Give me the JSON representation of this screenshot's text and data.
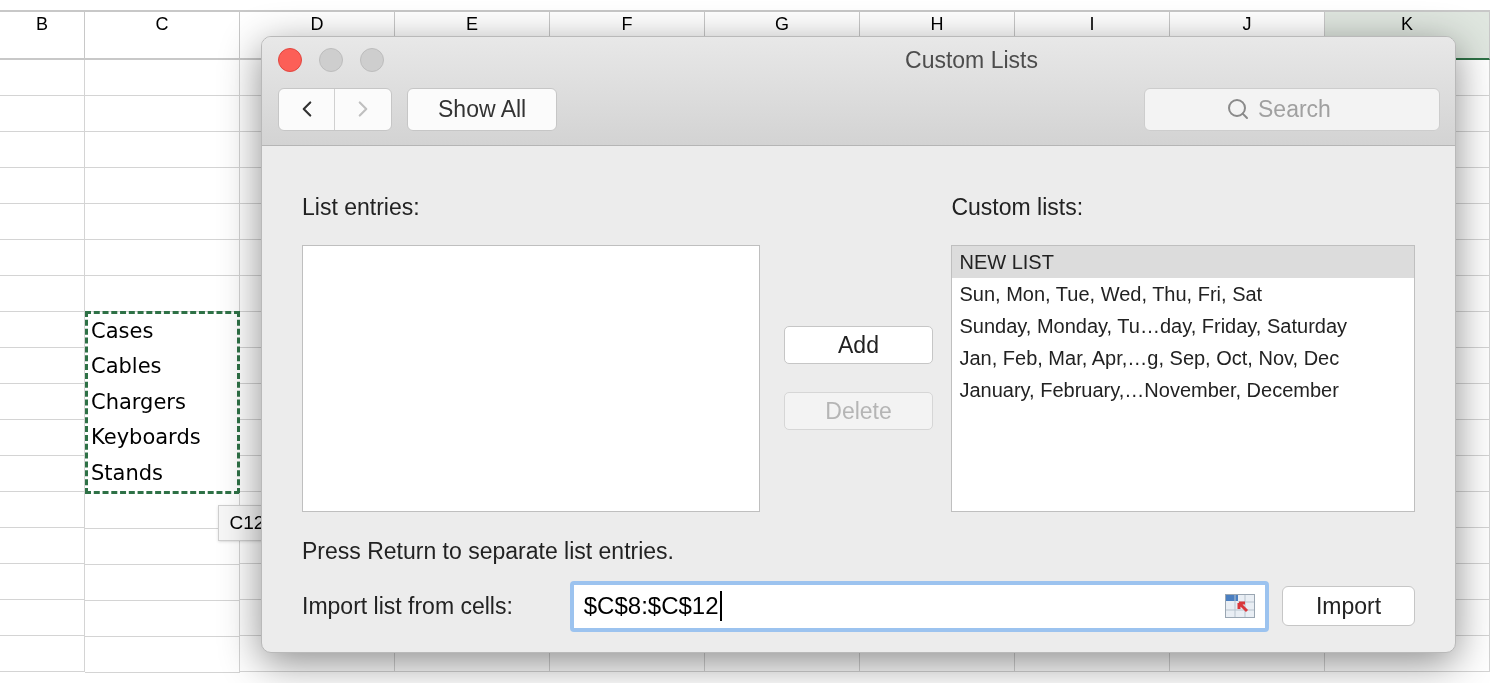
{
  "sheet": {
    "columns": [
      {
        "label": "B",
        "selected": false
      },
      {
        "label": "C",
        "selected": false
      },
      {
        "label": "D",
        "selected": false
      },
      {
        "label": "E",
        "selected": false
      },
      {
        "label": "F",
        "selected": false
      },
      {
        "label": "G",
        "selected": false
      },
      {
        "label": "H",
        "selected": false
      },
      {
        "label": "I",
        "selected": false
      },
      {
        "label": "J",
        "selected": false
      },
      {
        "label": "K",
        "selected": true
      }
    ],
    "copied_cells": [
      "Cases",
      "Cables",
      "Chargers",
      "Keyboards",
      "Stands"
    ],
    "cell_tooltip": "C12"
  },
  "dialog": {
    "title": "Custom Lists",
    "nav": [
      {
        "kind": "back",
        "disabled": false
      },
      {
        "kind": "forward",
        "disabled": true
      }
    ],
    "show_all": "Show All",
    "search": {
      "placeholder": "Search"
    },
    "list_entries_label": "List entries:",
    "custom_lists_label": "Custom lists:",
    "custom_lists": [
      {
        "label": "NEW LIST",
        "selected": true
      },
      {
        "label": "Sun, Mon, Tue, Wed, Thu, Fri, Sat",
        "selected": false
      },
      {
        "label": "Sunday, Monday, Tu…day, Friday, Saturday",
        "selected": false
      },
      {
        "label": "Jan, Feb, Mar, Apr,…g, Sep, Oct, Nov, Dec",
        "selected": false
      },
      {
        "label": "January, February,…November, December",
        "selected": false
      }
    ],
    "buttons": [
      {
        "label": "Add",
        "disabled": false
      },
      {
        "label": "Delete",
        "disabled": true
      }
    ],
    "hint": "Press Return to separate list entries.",
    "import_label": "Import list from cells:",
    "import_field": {
      "value": "$C$8:$C$12",
      "focused": true
    },
    "import_button": "Import"
  }
}
